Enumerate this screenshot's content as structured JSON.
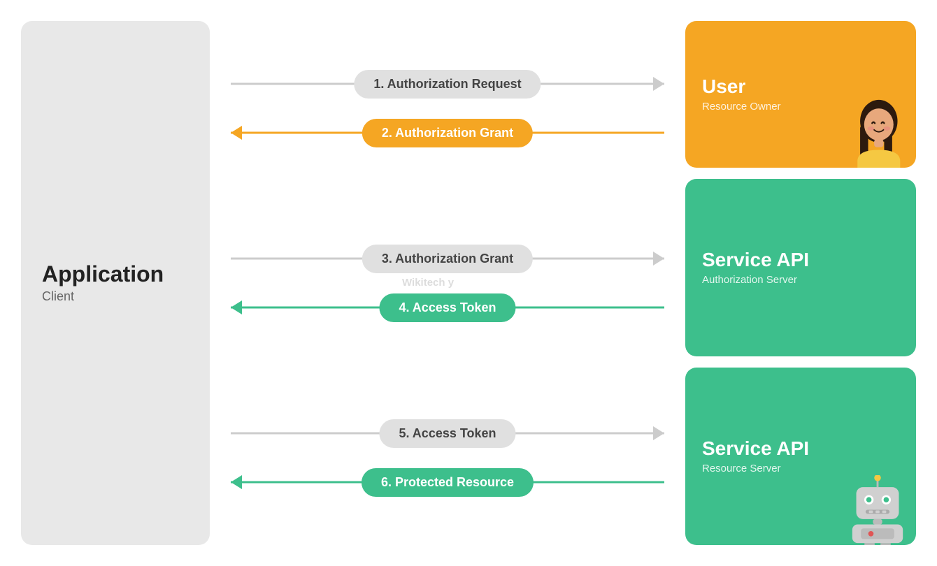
{
  "client": {
    "title": "Application",
    "subtitle": "Client"
  },
  "flows": [
    {
      "id": "flow1",
      "arrows": [
        {
          "id": "arrow1",
          "label": "1. Authorization Request",
          "direction": "right",
          "style": "gray"
        },
        {
          "id": "arrow2",
          "label": "2. Authorization Grant",
          "direction": "left",
          "style": "orange"
        }
      ]
    },
    {
      "id": "flow2",
      "arrows": [
        {
          "id": "arrow3",
          "label": "3. Authorization Grant",
          "direction": "right",
          "style": "gray"
        },
        {
          "id": "arrow4",
          "label": "4. Access Token",
          "direction": "left",
          "style": "green"
        }
      ]
    },
    {
      "id": "flow3",
      "arrows": [
        {
          "id": "arrow5",
          "label": "5. Access Token",
          "direction": "right",
          "style": "gray"
        },
        {
          "id": "arrow6",
          "label": "6. Protected Resource",
          "direction": "left",
          "style": "green"
        }
      ]
    }
  ],
  "boxes": [
    {
      "id": "user-box",
      "title": "User",
      "subtitle": "Resource Owner",
      "color": "orange",
      "avatar": "person"
    },
    {
      "id": "auth-server-box",
      "title": "Service API",
      "subtitle": "Authorization Server",
      "color": "green",
      "avatar": null
    },
    {
      "id": "resource-server-box",
      "title": "Service API",
      "subtitle": "Resource Server",
      "color": "green",
      "avatar": "robot"
    }
  ],
  "watermark": "Wikitech y"
}
